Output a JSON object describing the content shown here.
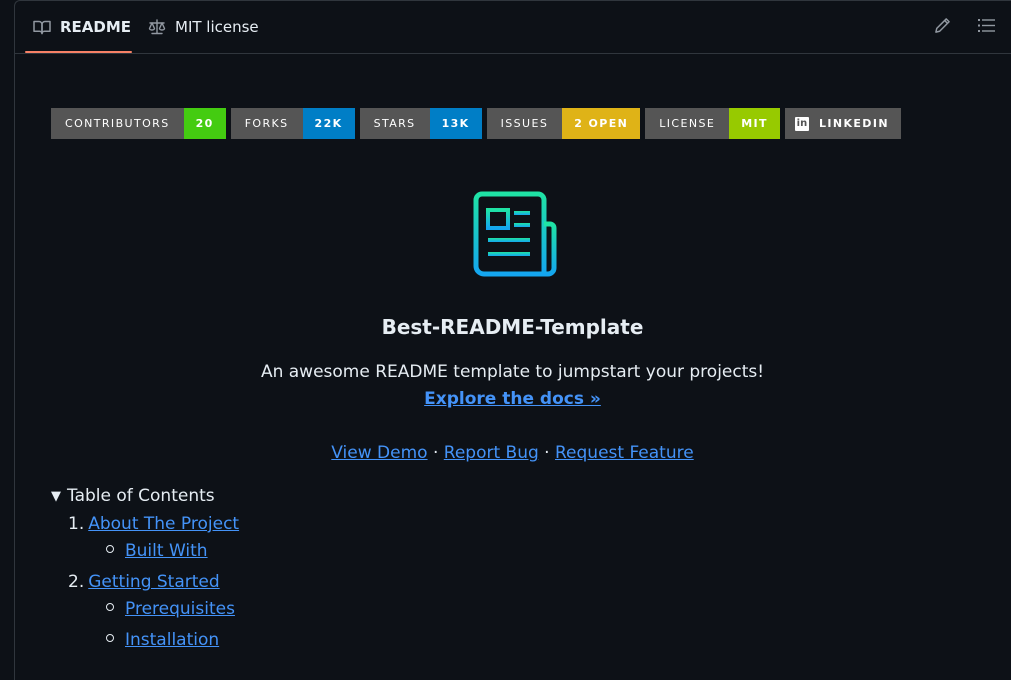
{
  "tabs": {
    "readme": "README",
    "license": "MIT license"
  },
  "badges": [
    {
      "key": "CONTRIBUTORS",
      "value": "20",
      "color": "#4c1"
    },
    {
      "key": "FORKS",
      "value": "22K",
      "color": "#007ec6"
    },
    {
      "key": "STARS",
      "value": "13K",
      "color": "#007ec6"
    },
    {
      "key": "ISSUES",
      "value": "2 OPEN",
      "color": "#dfb317"
    },
    {
      "key": "LICENSE",
      "value": "MIT",
      "color": "#97ca00"
    },
    {
      "key": "LINKEDIN",
      "value": "",
      "color": "#555"
    }
  ],
  "logo_icon": "newspaper-icon",
  "title": "Best-README-Template",
  "description": "An awesome README template to jumpstart your projects!",
  "docs_link": "Explore the docs »",
  "links": {
    "demo": "View Demo",
    "sep": " · ",
    "bug": "Report Bug",
    "feature": "Request Feature"
  },
  "toc": {
    "summary": "Table of Contents",
    "items": [
      {
        "num": "1.",
        "label": "About The Project",
        "children": [
          "Built With"
        ]
      },
      {
        "num": "2.",
        "label": "Getting Started",
        "children": [
          "Prerequisites",
          "Installation"
        ]
      }
    ]
  }
}
